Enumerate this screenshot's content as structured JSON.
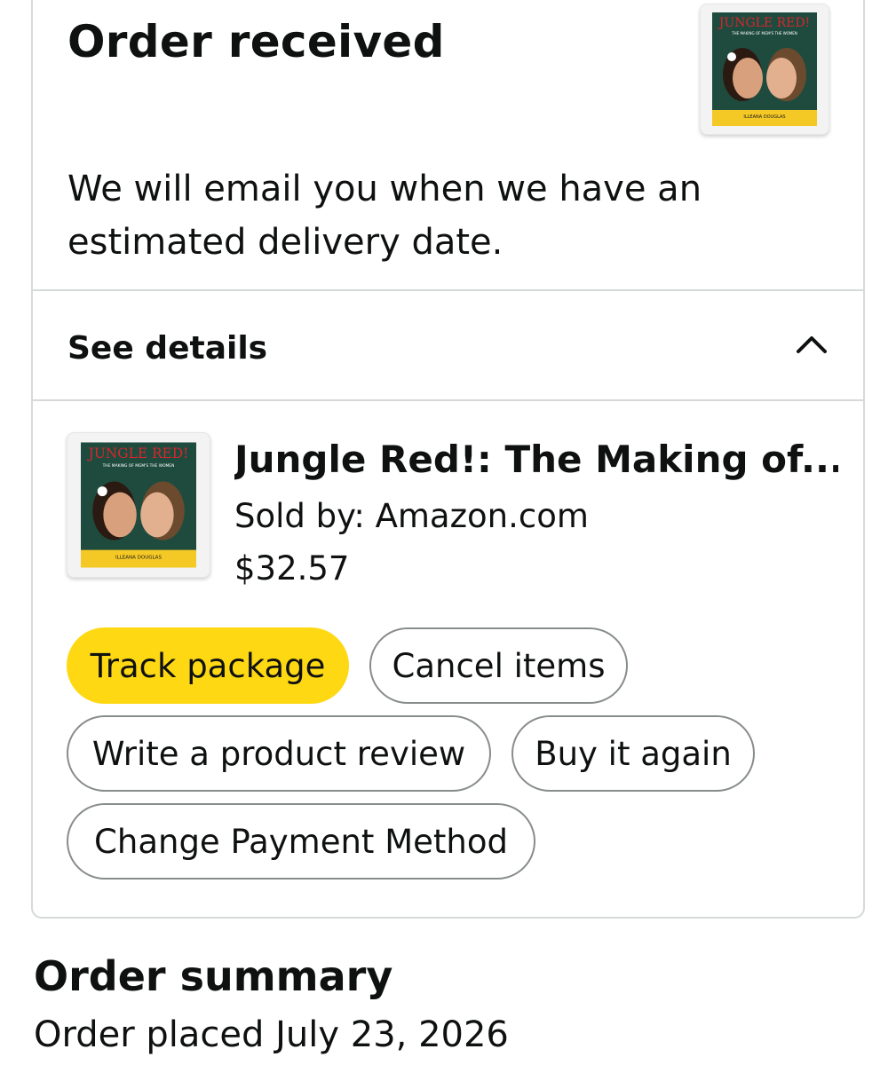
{
  "status": {
    "title": "Order received",
    "message": "We will email you when we have an estimated delivery date."
  },
  "details": {
    "label": "See details",
    "toggle_icon": "chevron-up-icon"
  },
  "item": {
    "cover": {
      "title_art": "JUNGLE RED!",
      "subtitle_art": "THE MAKING OF MGM'S THE WOMEN",
      "author_art": "ILLEANA DOUGLAS",
      "colors": {
        "background": "#1f4b3f",
        "title": "#d7262b",
        "band": "#f4c825",
        "skin": "#d9a07d",
        "hair": "#2b1a12"
      }
    },
    "title": "Jungle Red!: The Making of...",
    "sold_by": "Sold by: Amazon.com",
    "price": "$32.57"
  },
  "actions": {
    "track_package": "Track package",
    "cancel_items": "Cancel items",
    "write_review": "Write a product review",
    "buy_again": "Buy it again",
    "change_payment": "Change Payment Method"
  },
  "summary": {
    "title": "Order summary",
    "order_placed": "Order placed July 23, 2026"
  },
  "colors": {
    "primary_button": "#ffd814",
    "button_border": "#888c8c",
    "divider": "#d5d9d9",
    "text": "#0f1111"
  }
}
